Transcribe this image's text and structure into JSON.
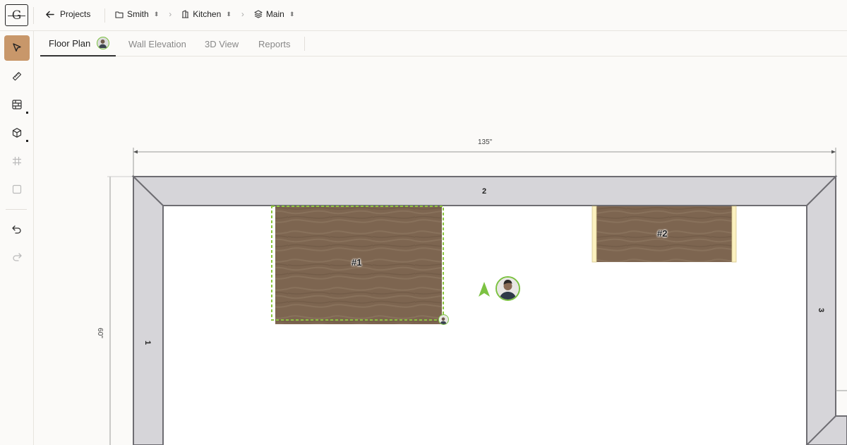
{
  "topbar": {
    "logo_letter": "G",
    "back_label": "Projects",
    "breadcrumbs": [
      {
        "label": "Smith",
        "icon": "folder-icon"
      },
      {
        "label": "Kitchen",
        "icon": "room-icon"
      },
      {
        "label": "Main",
        "icon": "layers-icon"
      }
    ]
  },
  "toolbar": {
    "tools": [
      "select-tool",
      "measure-tool",
      "wall-tool",
      "cabinet-tool",
      "grid-tool",
      "shape-tool",
      "undo",
      "redo"
    ]
  },
  "tabs": {
    "items": [
      {
        "label": "Floor Plan"
      },
      {
        "label": "Wall Elevation"
      },
      {
        "label": "3D View"
      },
      {
        "label": "Reports"
      }
    ]
  },
  "plan": {
    "width_dimension": "135\"",
    "height_dimension": "60\"",
    "walls": [
      "1",
      "2",
      "3"
    ],
    "cabinets": [
      {
        "label": "#1"
      },
      {
        "label": "#2"
      }
    ],
    "colors": {
      "wall_fill": "#d6d5d9",
      "wall_stroke": "#6e6d72",
      "cabinet_wood": "#7d6550",
      "selection": "#8dc63f",
      "active_tool": "#c8976a"
    }
  }
}
